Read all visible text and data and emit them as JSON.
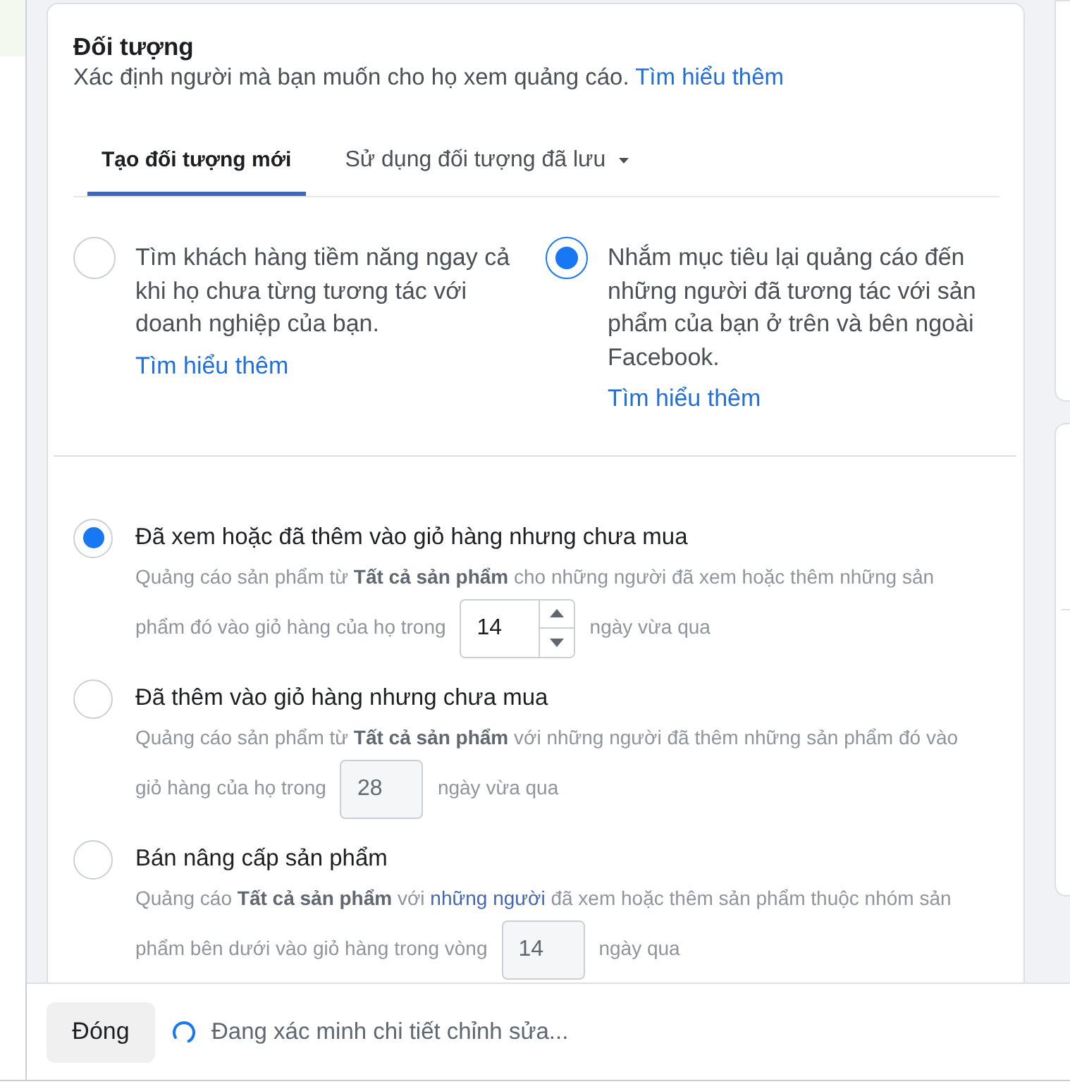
{
  "audience": {
    "title": "Đối tượng",
    "description": "Xác định người mà bạn muốn cho họ xem quảng cáo.",
    "learn_more": "Tìm hiểu thêm"
  },
  "tabs": [
    {
      "label": "Tạo đối tượng mới",
      "selected": true,
      "dropdown": false
    },
    {
      "label": "Sử dụng đối tượng đã lưu",
      "selected": false,
      "dropdown": true
    }
  ],
  "strategies": [
    {
      "text": "Tìm khách hàng tiềm năng ngay cả khi họ chưa từng tương tác với doanh nghiệp của bạn.",
      "link": "Tìm hiểu thêm",
      "selected": false
    },
    {
      "text": "Nhắm mục tiêu lại quảng cáo đến những người đã tương tác với sản phẩm của bạn ở trên và bên ngoài Facebook.",
      "link": "Tìm hiểu thêm",
      "selected": true
    }
  ],
  "options": [
    {
      "title": "Đã xem hoặc đã thêm vào giỏ hàng nhưng chưa mua",
      "selected": true,
      "description": [
        {
          "kind": "text",
          "text": "Quảng cáo sản phẩm từ **Tất cả sản phẩm** cho những người đã xem hoặc thêm những sản phẩm đó vào giỏ hàng của họ trong"
        }
      ],
      "days": "14",
      "disabled": false,
      "suffix": "ngày vừa qua"
    },
    {
      "title": "Đã thêm vào giỏ hàng nhưng chưa mua",
      "selected": false,
      "description": [
        {
          "kind": "text",
          "text": "Quảng cáo sản phẩm từ **Tất cả sản phẩm** với những người đã thêm những sản phẩm đó vào giỏ hàng của họ trong"
        }
      ],
      "days": "28",
      "disabled": true,
      "suffix": "ngày vừa qua"
    },
    {
      "title": "Bán nâng cấp sản phẩm",
      "selected": false,
      "description": [
        {
          "kind": "text",
          "text": "Quảng cáo **Tất cả sản phẩm** với"
        },
        {
          "kind": "link",
          "text": "những người"
        },
        {
          "kind": "text",
          "text": "đã xem hoặc thêm sản phẩm thuộc nhóm sản phẩm bên dưới vào giỏ hàng trong vòng"
        }
      ],
      "days": "14",
      "disabled": true,
      "suffix": "ngày qua"
    }
  ],
  "footer": {
    "close_button": "Đóng",
    "loading": true,
    "status": "Đang xác minh chi tiết chỉnh sửa..."
  }
}
